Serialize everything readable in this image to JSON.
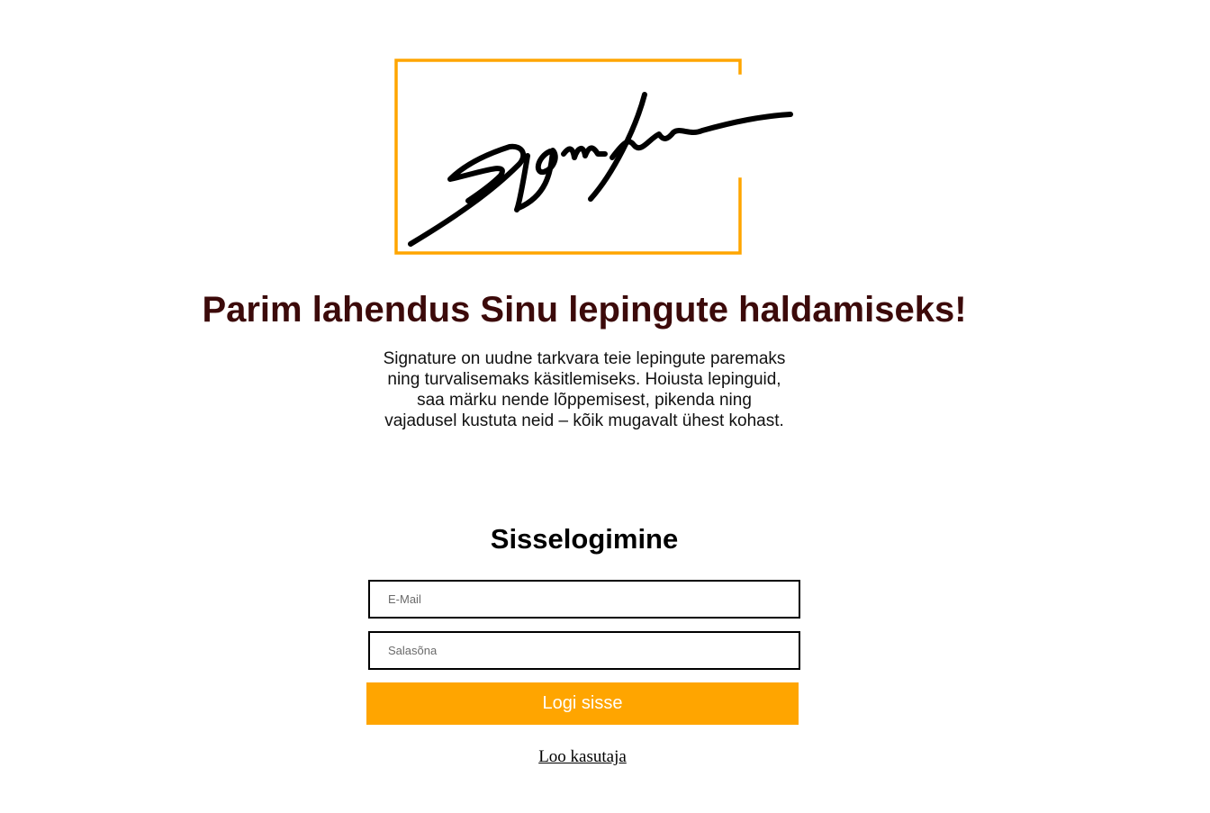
{
  "brand": {
    "logo_text": "Signature",
    "accent_color": "#ffa500",
    "headline_color": "#3c0a0a"
  },
  "hero": {
    "headline": "Parim lahendus Sinu lepingute haldamiseks!",
    "description": "Signature on uudne tarkvara teie lepingute paremaks ning turvalisemaks käsitlemiseks. Hoiusta lepinguid, saa märku nende lõppemisest, pikenda ning vajadusel kustuta neid – kõik mugavalt ühest kohast."
  },
  "login": {
    "title": "Sisselogimine",
    "email_placeholder": "E-Mail",
    "email_value": "",
    "password_placeholder": "Salasõna",
    "password_value": "",
    "submit_label": "Logi sisse",
    "register_link": "Loo kasutaja"
  }
}
